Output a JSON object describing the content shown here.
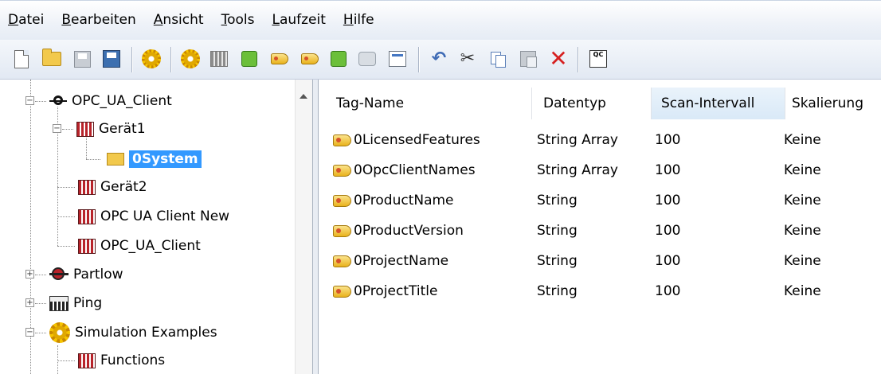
{
  "menu": [
    {
      "first": "D",
      "rest": "atei"
    },
    {
      "first": "B",
      "rest": "earbeiten"
    },
    {
      "first": "A",
      "rest": "nsicht"
    },
    {
      "first": "T",
      "rest": "ools"
    },
    {
      "first": "L",
      "rest": "aufzeit"
    },
    {
      "first": "H",
      "rest": "ilfe"
    }
  ],
  "toolbar": {
    "qc_label": "QC"
  },
  "tree": [
    {
      "label": "OPC_UA_Client",
      "icon": "opc-icon",
      "expander": "−"
    },
    {
      "label": "Gerät1",
      "icon": "device-icon",
      "expander": "−"
    },
    {
      "label": "0System",
      "icon": "folder-icon",
      "selected": true
    },
    {
      "label": "Gerät2",
      "icon": "device-icon"
    },
    {
      "label": "OPC UA Client New",
      "icon": "device-icon"
    },
    {
      "label": "OPC_UA_Client",
      "icon": "device-icon"
    },
    {
      "label": "Partlow",
      "icon": "partlow-icon",
      "expander": "+"
    },
    {
      "label": "Ping",
      "icon": "ping-icon",
      "expander": "+"
    },
    {
      "label": "Simulation Examples",
      "icon": "gear-icon",
      "expander": "−"
    },
    {
      "label": "Functions",
      "icon": "device-icon"
    }
  ],
  "list": {
    "columns": [
      "Tag-Name",
      "Datentyp",
      "Scan-Intervall",
      "Skalierung"
    ],
    "rows": [
      [
        "0LicensedFeatures",
        "String Array",
        "100",
        "Keine"
      ],
      [
        "0OpcClientNames",
        "String Array",
        "100",
        "Keine"
      ],
      [
        "0ProductName",
        "String",
        "100",
        "Keine"
      ],
      [
        "0ProductVersion",
        "String",
        "100",
        "Keine"
      ],
      [
        "0ProjectName",
        "String",
        "100",
        "Keine"
      ],
      [
        "0ProjectTitle",
        "String",
        "100",
        "Keine"
      ]
    ]
  }
}
